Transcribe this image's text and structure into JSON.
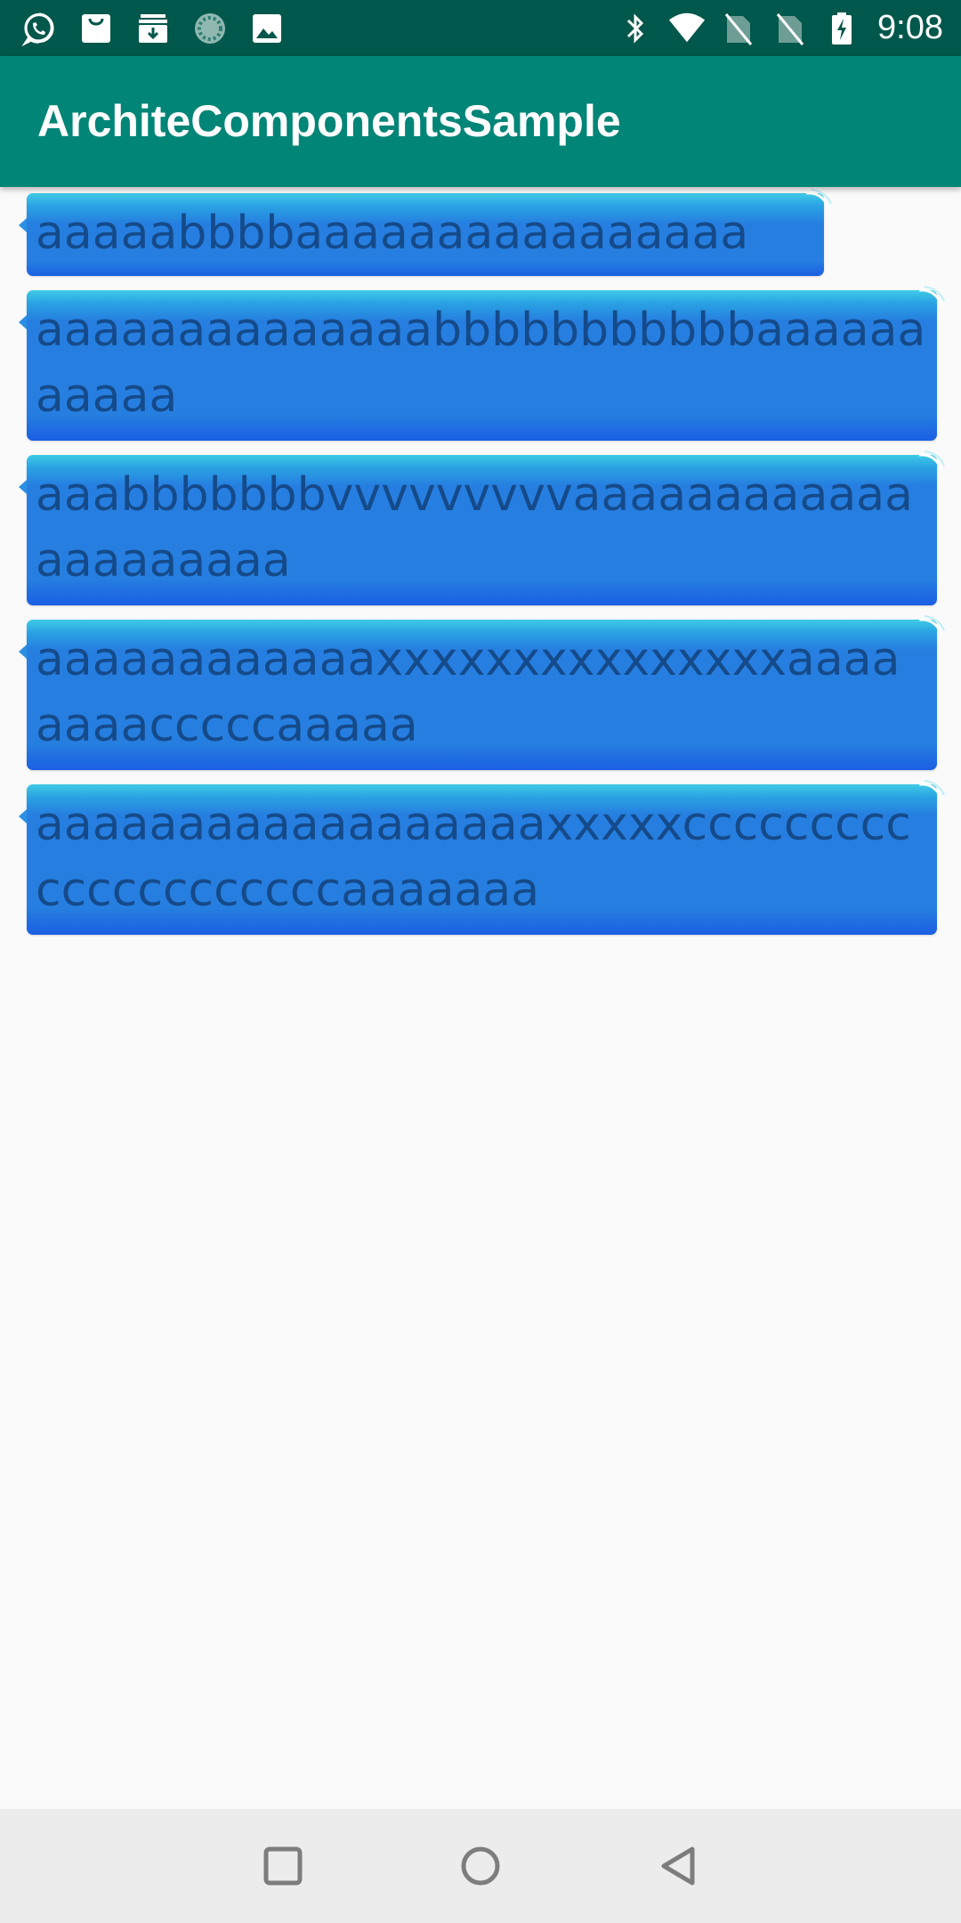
{
  "status_bar": {
    "time": "9:08",
    "left_icons": [
      "whatsapp-icon",
      "shopping-bag-icon",
      "archive-download-icon",
      "loading-circle-icon",
      "image-icon"
    ],
    "right_icons": [
      "bluetooth-icon",
      "wifi-icon",
      "no-sim-icon",
      "no-sim-icon",
      "battery-charging-icon"
    ]
  },
  "app_bar": {
    "title": "ArchiteComponentsSample"
  },
  "messages": [
    {
      "text": "aaaaabbbbaaaaaaaaaaaaaaaa"
    },
    {
      "text": "aaaaaaaaaaaaaabbbbbbbbbbbaaaaaaaaaaa"
    },
    {
      "text": "aaabbbbbbbvvvvvvvvvaaaaaaaaaaaaaaaaaaaaa"
    },
    {
      "text": "aaaaaaaaaaaaxxxxxxxxxxxxxxxaaaaaaaacccccaaaaa"
    },
    {
      "text": "aaaaaaaaaaaaaaaaaaxxxxxcccccccccccccccccccccaaaaaaa"
    }
  ],
  "nav_bar": {
    "buttons": [
      "recents-button",
      "home-button",
      "back-button"
    ]
  },
  "colors": {
    "status_bar": "#00574b",
    "app_bar": "#008577",
    "bubble_top": "#3fcbe6",
    "bubble_main": "#267fe0",
    "bubble_text": "#154a8a",
    "background": "#fafafa",
    "nav_bar": "#ececec"
  }
}
